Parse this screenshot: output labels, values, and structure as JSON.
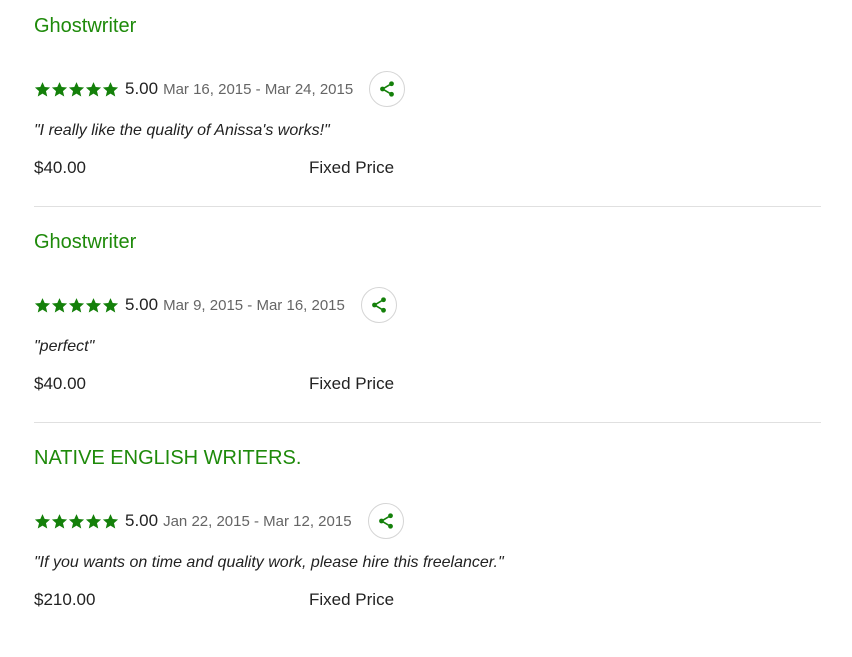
{
  "colors": {
    "accent_green": "#1e8a0a",
    "star_green": "#14800a",
    "text": "#222222",
    "muted": "#656565",
    "divider": "#e0e0e0"
  },
  "reviews": [
    {
      "title": "Ghostwriter",
      "stars": 5,
      "score": "5.00",
      "dates": "Mar 16, 2015 - Mar 24, 2015",
      "feedback": "\"I really like the quality of Anissa's works!\"",
      "amount": "$40.00",
      "price_type": "Fixed Price",
      "share_icon": "share-icon"
    },
    {
      "title": "Ghostwriter",
      "stars": 5,
      "score": "5.00",
      "dates": "Mar 9, 2015 - Mar 16, 2015",
      "feedback": "\"perfect\"",
      "amount": "$40.00",
      "price_type": "Fixed Price",
      "share_icon": "share-icon"
    },
    {
      "title": "NATIVE ENGLISH WRITERS.",
      "stars": 5,
      "score": "5.00",
      "dates": "Jan 22, 2015 - Mar 12, 2015",
      "feedback": "\"If you wants on time and quality work, please hire this freelancer.\"",
      "amount": "$210.00",
      "price_type": "Fixed Price",
      "share_icon": "share-icon"
    }
  ]
}
